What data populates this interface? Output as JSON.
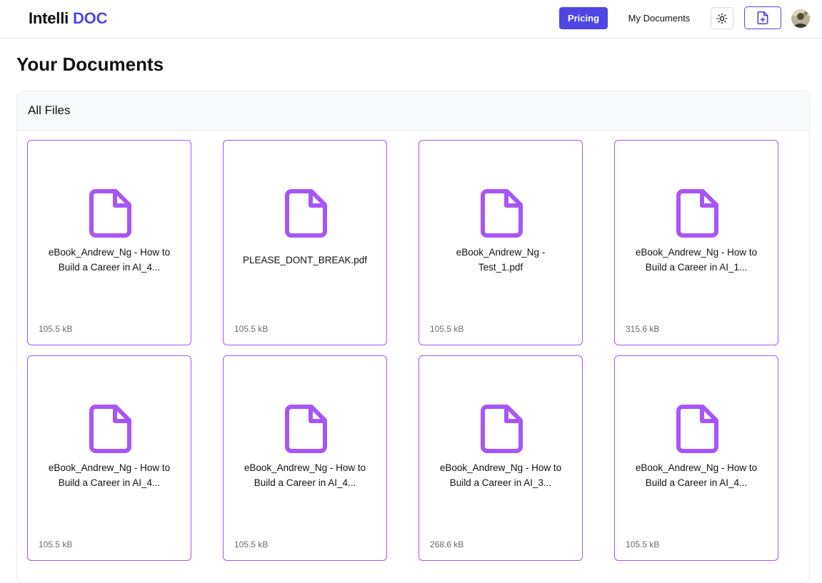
{
  "app": {
    "logo_main": "Intelli",
    "logo_accent": "DOC"
  },
  "nav": {
    "pricing_label": "Pricing",
    "my_documents_label": "My Documents",
    "theme_icon": "sun-icon",
    "upload_icon": "file-plus-icon"
  },
  "page": {
    "title": "Your Documents"
  },
  "panel": {
    "title": "All Files"
  },
  "files": [
    {
      "name": "eBook_Andrew_Ng - How to Build a Career in AI_4...",
      "size": "105.5 kB"
    },
    {
      "name": "PLEASE_DONT_BREAK.pdf",
      "size": "105.5 kB"
    },
    {
      "name": "eBook_Andrew_Ng - Test_1.pdf",
      "size": "105.5 kB"
    },
    {
      "name": "eBook_Andrew_Ng - How to Build a Career in AI_1...",
      "size": "315.6 kB"
    },
    {
      "name": "eBook_Andrew_Ng - How to Build a Career in AI_4...",
      "size": "105.5 kB"
    },
    {
      "name": "eBook_Andrew_Ng - How to Build a Career in AI_4...",
      "size": "105.5 kB"
    },
    {
      "name": "eBook_Andrew_Ng - How to Build a Career in AI_3...",
      "size": "268.6 kB"
    },
    {
      "name": "eBook_Andrew_Ng - How to Build a Career in AI_4...",
      "size": "105.5 kB"
    }
  ],
  "colors": {
    "brand": "#4f46e5",
    "card_border": "#a855f7",
    "file_icon": "#a855f7"
  }
}
